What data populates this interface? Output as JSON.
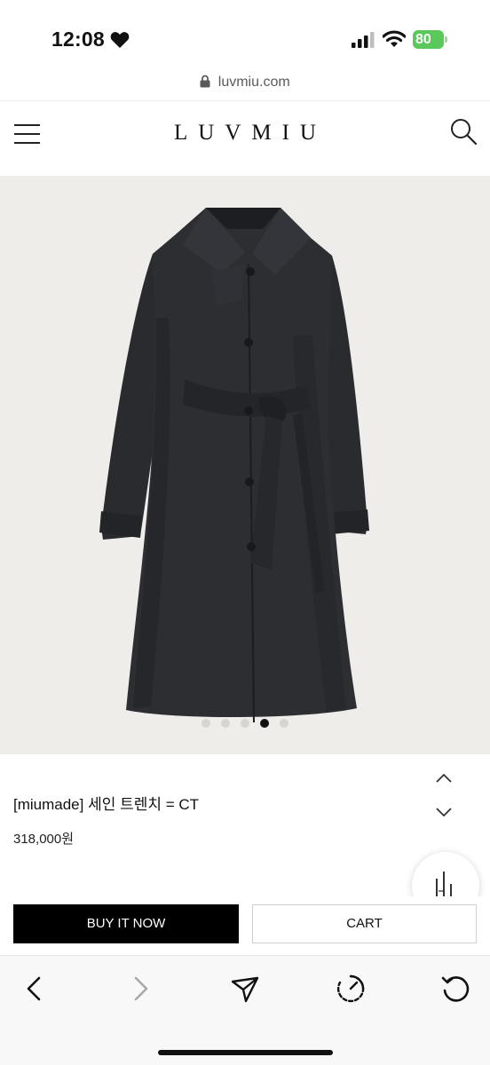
{
  "status": {
    "time": "12:08",
    "battery": "80"
  },
  "browser": {
    "url": "luvmiu.com"
  },
  "header": {
    "logo": "LUVMIU"
  },
  "carousel": {
    "slide_count": 5,
    "active_index": 3
  },
  "product": {
    "name": "[miumade] 세인 트렌치 = CT",
    "price": "318,000원"
  },
  "actions": {
    "buy_label": "BUY IT NOW",
    "cart_label": "CART"
  },
  "colors": {
    "accent": "#000000",
    "battery": "#5ac85a",
    "image_background": "#eeedea"
  },
  "icons": [
    "heart-icon",
    "signal-icon",
    "wifi-icon",
    "battery-icon",
    "lock-icon",
    "menu-icon",
    "search-icon",
    "chevron-up-icon",
    "chevron-down-icon",
    "size-chart-icon",
    "back-icon",
    "forward-icon",
    "share-icon",
    "speed-icon",
    "reload-icon"
  ]
}
